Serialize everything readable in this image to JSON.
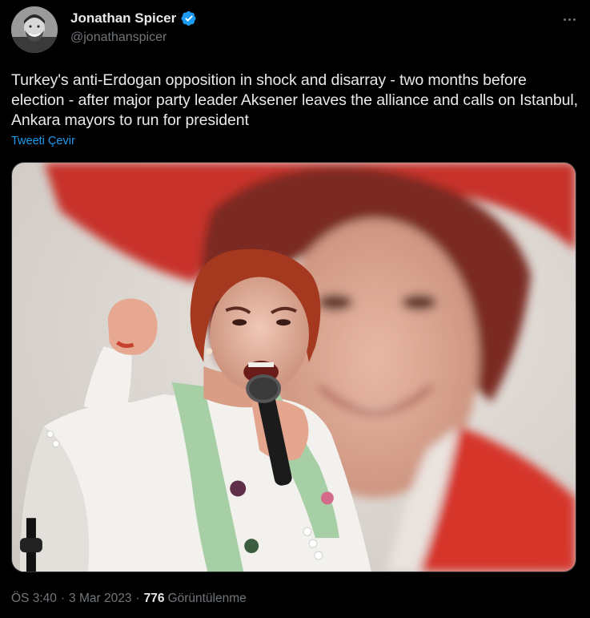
{
  "author": {
    "display_name": "Jonathan Spicer",
    "handle": "@jonathanspicer",
    "verified": true
  },
  "tweet": {
    "text": "Turkey's anti-Erdogan opposition in shock and disarray - two months before election - after major party leader Aksener leaves the alliance and calls on Istanbul, Ankara mayors to run for president",
    "translate_label": "Tweeti Çevir",
    "time": "ÖS 3:40",
    "date": "3 Mar 2023",
    "separator": "·",
    "views_count": "776",
    "views_label": "Görüntülenme"
  },
  "icons": {
    "verified": "verified-badge-icon",
    "more": "more-options-icon"
  },
  "colors": {
    "background": "#000000",
    "text_primary": "#e7e9ea",
    "text_secondary": "#71767b",
    "link": "#1d9bf0",
    "verified": "#1d9bf0"
  }
}
